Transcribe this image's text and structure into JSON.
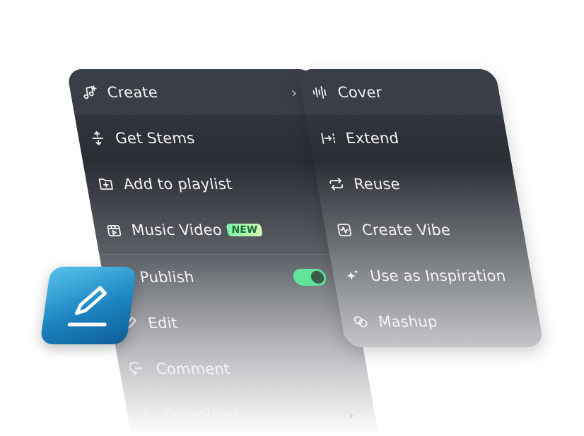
{
  "left_menu": {
    "items": [
      {
        "label": "Create",
        "icon": "music-note-plus-icon"
      },
      {
        "label": "Get Stems",
        "icon": "split-arrows-icon"
      },
      {
        "label": "Add to playlist",
        "icon": "folder-plus-icon"
      },
      {
        "label": "Music Video",
        "icon": "video-clip-icon",
        "badge": "NEW"
      },
      {
        "label": "Publish",
        "icon": "upload-icon",
        "toggle_on": true
      },
      {
        "label": "Edit",
        "icon": "pencil-icon"
      },
      {
        "label": "Comment",
        "icon": "comment-icon"
      },
      {
        "label": "Download",
        "icon": "download-icon"
      }
    ]
  },
  "right_menu": {
    "items": [
      {
        "label": "Cover",
        "icon": "waveform-icon"
      },
      {
        "label": "Extend",
        "icon": "extend-icon"
      },
      {
        "label": "Reuse",
        "icon": "repeat-icon"
      },
      {
        "label": "Create Vibe",
        "icon": "pulse-icon"
      },
      {
        "label": "Use as Inspiration",
        "icon": "sparkles-icon"
      },
      {
        "label": "Mashup",
        "icon": "link-circles-icon"
      }
    ]
  },
  "colors": {
    "toggle_on": "#62e39a",
    "badge_bg": "#a8f2b8",
    "edit_tile": "#1c84c0"
  }
}
